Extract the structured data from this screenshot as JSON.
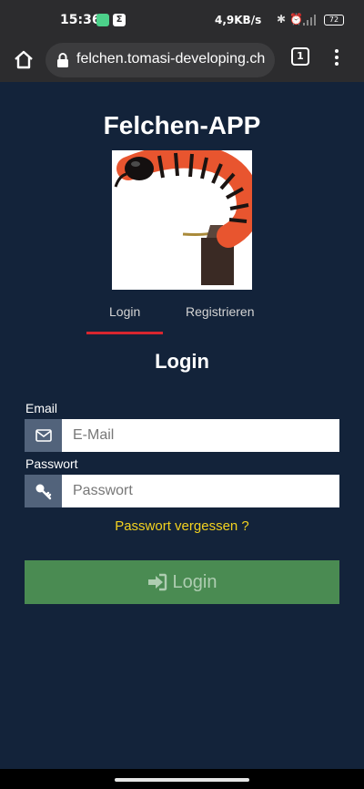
{
  "status_bar": {
    "time": "15:36",
    "notif_icon_label": "Σ",
    "network_speed": "4,9KB/s",
    "battery": "72"
  },
  "browser": {
    "url": "felchen.tomasi-developing.ch",
    "tab_count": "1"
  },
  "app": {
    "title": "Felchen-APP"
  },
  "tabs": [
    {
      "label": "Login",
      "active": true
    },
    {
      "label": "Registrieren",
      "active": false
    }
  ],
  "form": {
    "heading": "Login",
    "email_label": "Email",
    "email_placeholder": "E-Mail",
    "password_label": "Passwort",
    "password_placeholder": "Passwort",
    "forgot_link": "Passwort vergessen ?",
    "submit_label": "Login"
  },
  "colors": {
    "background": "#13233a",
    "tab_active_underline": "#d8262f",
    "forgot_link": "#f3d21f",
    "submit_button": "#4a8b52",
    "input_addon": "#52637b"
  }
}
